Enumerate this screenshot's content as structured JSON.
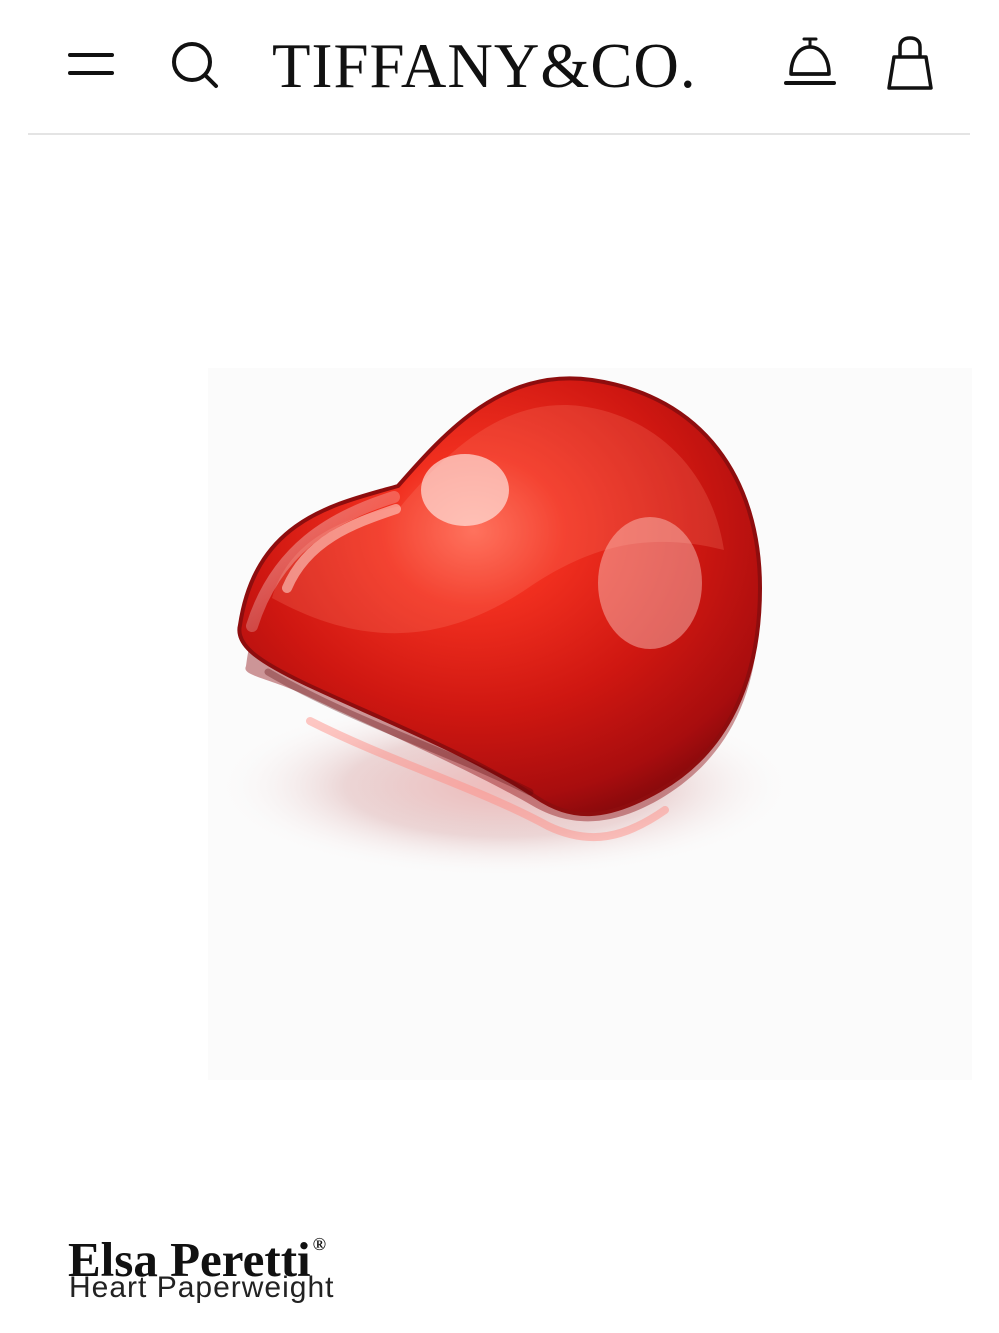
{
  "header": {
    "logo_text": "TIFFANY&CO.",
    "icons": {
      "menu": "menu-icon",
      "search": "search-icon",
      "concierge": "concierge-bell-icon",
      "bag": "shopping-bag-icon"
    }
  },
  "product": {
    "designer": "Elsa Peretti",
    "designer_mark": "®",
    "name": "Heart Paperweight",
    "image": "red-heart-paperweight"
  },
  "colors": {
    "background": "#ffffff",
    "divider": "#e4e4e4",
    "text": "#111111",
    "product_red": "#d91f16"
  }
}
